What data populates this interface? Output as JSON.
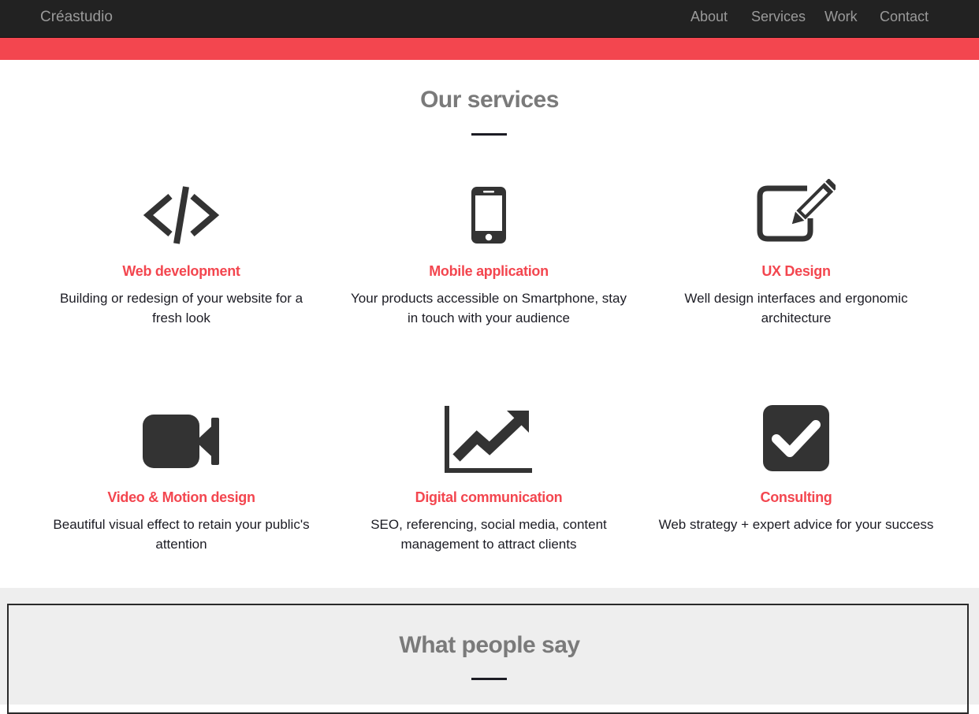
{
  "nav": {
    "brand": "Créastudio",
    "links": [
      "About",
      "Services",
      "Work",
      "Contact"
    ]
  },
  "services_section": {
    "title": "Our services",
    "items": [
      {
        "icon": "code-icon",
        "name": "Web development",
        "desc": "Building or redesign of your website for a fresh look"
      },
      {
        "icon": "smartphone-icon",
        "name": "Mobile application",
        "desc": "Your products accessible on Smartphone, stay in touch with your audience"
      },
      {
        "icon": "edit-icon",
        "name": "UX Design",
        "desc": "Well design interfaces and ergonomic architecture"
      },
      {
        "icon": "video-camera-icon",
        "name": "Video & Motion design",
        "desc": "Beautiful visual effect to retain your public's attention"
      },
      {
        "icon": "chart-trend-icon",
        "name": "Digital communication",
        "desc": "SEO, referencing, social media, content management to attract clients"
      },
      {
        "icon": "checkbox-icon",
        "name": "Consulting",
        "desc": "Web strategy + expert advice for your success"
      }
    ]
  },
  "testimonials_section": {
    "title": "What people say"
  },
  "colors": {
    "accent": "#f3464f",
    "navbar": "#222222",
    "icon": "#333333",
    "muted_title": "#7a7a7a",
    "testimonials_bg": "#eeeeee"
  }
}
